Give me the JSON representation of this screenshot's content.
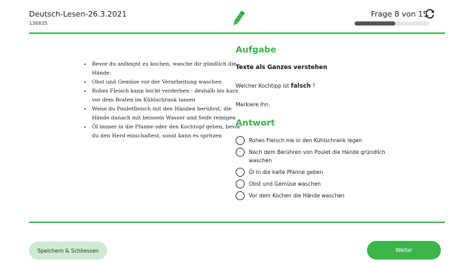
{
  "header": {
    "title": "Deutsch-Lesen-26.3.2021",
    "id": "136835",
    "progress_text": "Frage 8 von 15",
    "progress_fraction": 0.55
  },
  "passage": {
    "items": [
      "Bevor du anfängst zu kochen, wasche dir gündlich die Hände.",
      "Obst und Gemüse vor der Verarbeitung waschen",
      "Rohes Fleisch kann leicht verderben - deshalb bis kurz vor dem Braten im Kühlschrank lassen",
      "Wenn du Pouletfleisch mit den Händen berührst, die Hände danach mit heissem Wasser und Seife reinigen",
      "Öl immer in die Pfanne oder den Kochtopf geben, bevor du den Herd einschaltest, sonst kann es spritzen"
    ]
  },
  "task": {
    "heading": "Aufgabe",
    "subtitle": "Texte als Ganzes verstehen",
    "question_prefix": "Welcher Kochtipp ist",
    "question_emphasis": "falsch",
    "question_suffix": "?",
    "instruction": "Markiere ihn."
  },
  "answer": {
    "heading": "Antwort",
    "options": [
      "Rohes Fleisch nie in den Kühlschrank legen",
      "Nach dem Berühren von Poulet die Hände gründlich waschen",
      "Öl  in die kalte Pfanne geben",
      "Obst und Gemüse waschen",
      "Vor dem Kochen die Hände waschen"
    ]
  },
  "footer": {
    "save_label": "Speichern & Schliessen",
    "next_label": "Weiter"
  },
  "colors": {
    "accent": "#3cb54a",
    "accent_light": "#cfead2",
    "progress_fill": "#555555"
  },
  "icons": {
    "header_center": "pencil-icon",
    "header_right": "refresh-icon"
  }
}
